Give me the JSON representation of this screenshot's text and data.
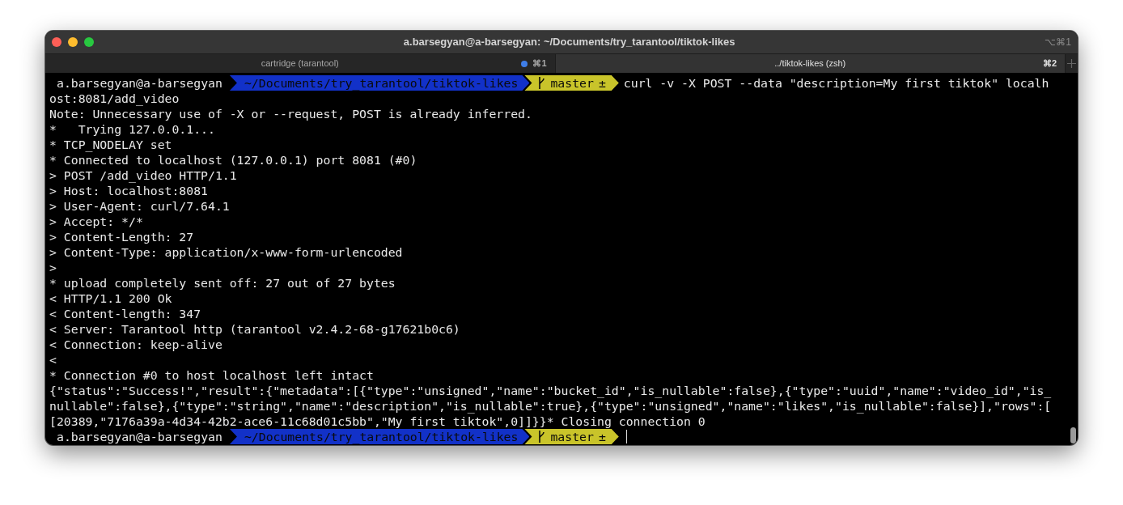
{
  "window": {
    "title": "a.barsegyan@a-barsegyan: ~/Documents/try_tarantool/tiktok-likes",
    "shortcut": "⌥⌘1"
  },
  "tabs": [
    {
      "label": "cartridge (tarantool)",
      "shortcut": "⌘1",
      "activity": true,
      "selected": false
    },
    {
      "label": "../tiktok-likes (zsh)",
      "shortcut": "⌘2",
      "activity": false,
      "selected": true
    }
  ],
  "terminal": {
    "lines": [
      {
        "kind": "prompt",
        "user": "a.barsegyan@a-barsegyan",
        "path": "~/Documents/try_tarantool/tiktok-likes",
        "branch": "master",
        "git_status": "±",
        "command": "curl -v -X POST --data \"description=My first tiktok\" localh",
        "cursor": false
      },
      {
        "kind": "output",
        "text": "ost:8081/add_video"
      },
      {
        "kind": "output",
        "text": "Note: Unnecessary use of -X or --request, POST is already inferred."
      },
      {
        "kind": "output",
        "text": "*   Trying 127.0.0.1..."
      },
      {
        "kind": "output",
        "text": "* TCP_NODELAY set"
      },
      {
        "kind": "output",
        "text": "* Connected to localhost (127.0.0.1) port 8081 (#0)"
      },
      {
        "kind": "output",
        "text": "> POST /add_video HTTP/1.1"
      },
      {
        "kind": "output",
        "text": "> Host: localhost:8081"
      },
      {
        "kind": "output",
        "text": "> User-Agent: curl/7.64.1"
      },
      {
        "kind": "output",
        "text": "> Accept: */*"
      },
      {
        "kind": "output",
        "text": "> Content-Length: 27"
      },
      {
        "kind": "output",
        "text": "> Content-Type: application/x-www-form-urlencoded"
      },
      {
        "kind": "output",
        "text": ">"
      },
      {
        "kind": "output",
        "text": "* upload completely sent off: 27 out of 27 bytes"
      },
      {
        "kind": "output",
        "text": "< HTTP/1.1 200 Ok"
      },
      {
        "kind": "output",
        "text": "< Content-length: 347"
      },
      {
        "kind": "output",
        "text": "< Server: Tarantool http (tarantool v2.4.2-68-g17621b0c6)"
      },
      {
        "kind": "output",
        "text": "< Connection: keep-alive"
      },
      {
        "kind": "output",
        "text": "<"
      },
      {
        "kind": "output",
        "text": "* Connection #0 to host localhost left intact"
      },
      {
        "kind": "output",
        "text": "{\"status\":\"Success!\",\"result\":{\"metadata\":[{\"type\":\"unsigned\",\"name\":\"bucket_id\",\"is_nullable\":false},{\"type\":\"uuid\",\"name\":\"video_id\",\"is_"
      },
      {
        "kind": "output",
        "text": "nullable\":false},{\"type\":\"string\",\"name\":\"description\",\"is_nullable\":true},{\"type\":\"unsigned\",\"name\":\"likes\",\"is_nullable\":false}],\"rows\":["
      },
      {
        "kind": "output",
        "text": "[20389,\"7176a39a-4d34-42b2-ace6-11c68d01c5bb\",\"My first tiktok\",0]]}}* Closing connection 0"
      },
      {
        "kind": "prompt",
        "user": "a.barsegyan@a-barsegyan",
        "path": "~/Documents/try_tarantool/tiktok-likes",
        "branch": "master",
        "git_status": "±",
        "cursor": true
      }
    ]
  }
}
